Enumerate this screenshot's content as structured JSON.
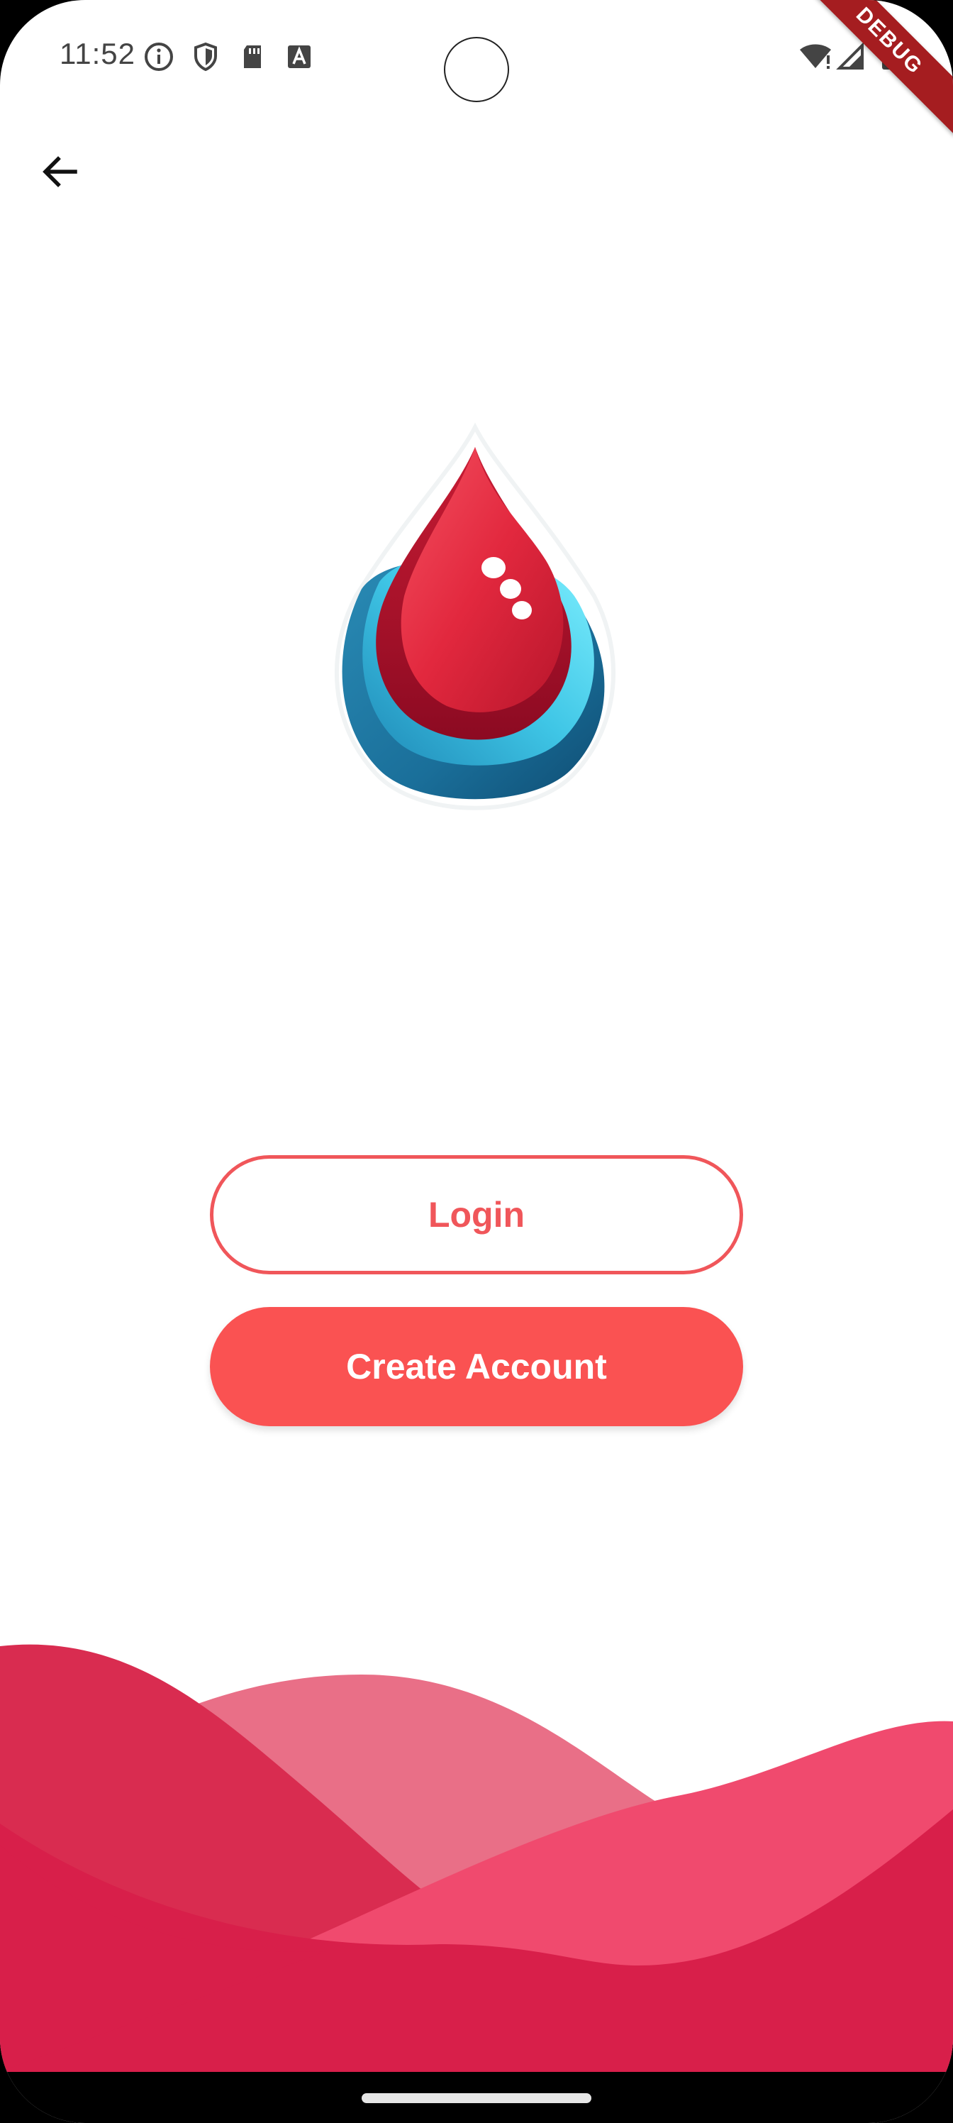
{
  "status_bar": {
    "time": "11:52",
    "icons": [
      "info-icon",
      "shield-icon",
      "sd-card-icon",
      "font-a-icon",
      "wifi-icon",
      "signal-icon",
      "battery-icon"
    ]
  },
  "debug_banner": {
    "label": "DEBUG",
    "color": "#a51d20"
  },
  "app_bar": {
    "back_icon": "arrow-back-icon"
  },
  "logo": {
    "icon": "blood-drop-logo-icon"
  },
  "buttons": {
    "login_label": "Login",
    "create_account_label": "Create Account"
  },
  "colors": {
    "accent": "#fa5252",
    "login_border": "#f0565a",
    "wave_dark": "#d81f4a",
    "wave_light": "#e96f87",
    "wave_mid": "#f0466b"
  }
}
